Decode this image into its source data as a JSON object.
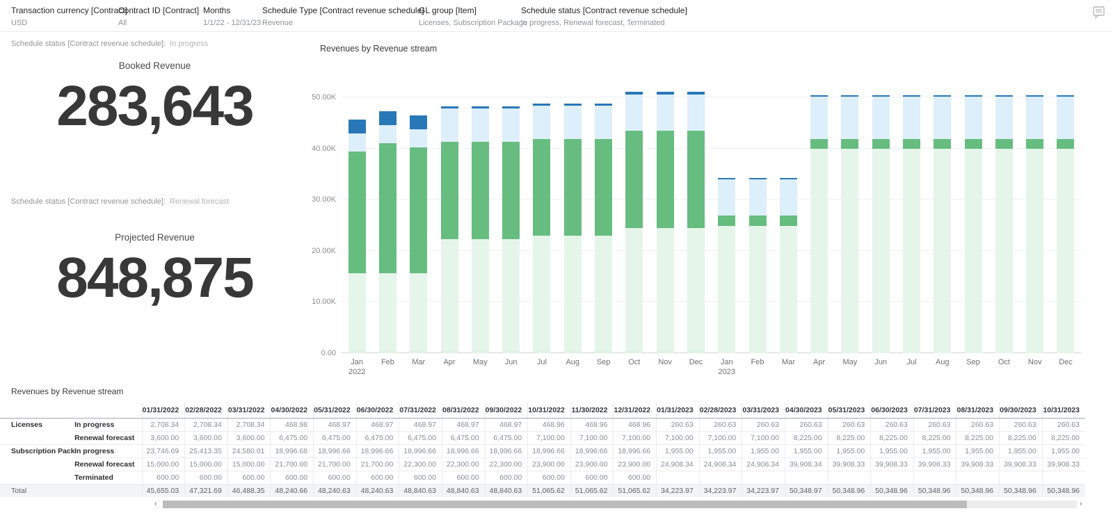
{
  "filters": [
    {
      "label": "Transaction currency [Contract]",
      "value": "USD"
    },
    {
      "label": "Contract ID [Contract]",
      "value": "All"
    },
    {
      "label": "Months",
      "value": "1/1/22 - 12/31/23"
    },
    {
      "label": "Schedule Type [Contract revenue schedule]",
      "value": "Revenue"
    },
    {
      "label": "GL group [Item]",
      "value": "Licenses, Subscription Package"
    },
    {
      "label": "Schedule status [Contract revenue schedule]",
      "value": "In progress, Renewal forecast, Terminated"
    }
  ],
  "kpis": [
    {
      "filter_label": "Schedule status [Contract revenue schedule]:",
      "filter_value": "In progress",
      "title": "Booked Revenue",
      "value": "283,643"
    },
    {
      "filter_label": "Schedule status [Contract revenue schedule]:",
      "filter_value": "Renewal forecast",
      "title": "Projected Revenue",
      "value": "848,875"
    }
  ],
  "chart_data": {
    "type": "bar",
    "stacked": true,
    "title": "Revenues by Revenue stream",
    "ylabel": "",
    "xlabel": "",
    "ylim": [
      0,
      50000
    ],
    "grid": true,
    "legend": "none",
    "y_ticks": [
      {
        "label": "0.00",
        "value": 0
      },
      {
        "label": "10.00K",
        "value": 10000
      },
      {
        "label": "20.00K",
        "value": 20000
      },
      {
        "label": "30.00K",
        "value": 30000
      },
      {
        "label": "40.00K",
        "value": 40000
      },
      {
        "label": "50.00K",
        "value": 50000
      }
    ],
    "categories": [
      {
        "month": "Jan",
        "year": "2022"
      },
      {
        "month": "Feb"
      },
      {
        "month": "Mar"
      },
      {
        "month": "Apr"
      },
      {
        "month": "May"
      },
      {
        "month": "Jun"
      },
      {
        "month": "Jul"
      },
      {
        "month": "Aug"
      },
      {
        "month": "Sep"
      },
      {
        "month": "Oct"
      },
      {
        "month": "Nov"
      },
      {
        "month": "Dec"
      },
      {
        "month": "Jan",
        "year": "2023"
      },
      {
        "month": "Feb"
      },
      {
        "month": "Mar"
      },
      {
        "month": "Apr"
      },
      {
        "month": "May"
      },
      {
        "month": "Jun"
      },
      {
        "month": "Jul"
      },
      {
        "month": "Aug"
      },
      {
        "month": "Sep"
      },
      {
        "month": "Oct"
      },
      {
        "month": "Nov"
      },
      {
        "month": "Dec"
      }
    ],
    "series": [
      {
        "name": "Subscription Package - Terminated",
        "color": "#e0f2e6",
        "values": [
          600,
          600,
          600,
          600,
          600,
          600,
          600,
          600,
          600,
          600,
          600,
          600,
          0,
          0,
          0,
          0,
          0,
          0,
          0,
          0,
          0,
          0,
          0,
          0
        ]
      },
      {
        "name": "Subscription Package - Renewal forecast",
        "color": "#e6f5ea",
        "values": [
          15000,
          15000,
          15000,
          21700,
          21700,
          21700,
          22300,
          22300,
          22300,
          23900,
          23900,
          23900,
          24908.34,
          24908.34,
          24908.34,
          39908.34,
          39908.33,
          39908.33,
          39908.33,
          39908.33,
          39908.33,
          39908.33,
          39908.33,
          39908.33
        ]
      },
      {
        "name": "Subscription Package - In progress",
        "color": "#66bd7f",
        "values": [
          23746.69,
          25413.35,
          24580.01,
          18996.68,
          18996.66,
          18996.66,
          18996.66,
          18996.66,
          18996.66,
          18996.66,
          18996.66,
          18996.66,
          1955,
          1955,
          1955,
          1955,
          1955,
          1955,
          1955,
          1955,
          1955,
          1955,
          1955,
          1955
        ]
      },
      {
        "name": "Licenses - Renewal forecast",
        "color": "#ddeffa",
        "values": [
          3600,
          3600,
          3600,
          6475,
          6475,
          6475,
          6475,
          6475,
          6475,
          7100,
          7100,
          7100,
          7100,
          7100,
          7100,
          8225,
          8225,
          8225,
          8225,
          8225,
          8225,
          8225,
          8225,
          8225
        ]
      },
      {
        "name": "Licenses - In progress",
        "color": "#2878b8",
        "values": [
          2708.34,
          2708.34,
          2708.34,
          468.98,
          468.97,
          468.97,
          468.97,
          468.97,
          468.97,
          468.96,
          468.96,
          468.96,
          260.63,
          260.63,
          260.63,
          260.63,
          260.63,
          260.63,
          260.63,
          260.63,
          260.63,
          260.63,
          260.63,
          260.63
        ]
      }
    ]
  },
  "table": {
    "title": "Revenues by Revenue stream",
    "columns": [
      "01/31/2022",
      "02/28/2022",
      "03/31/2022",
      "04/30/2022",
      "05/31/2022",
      "06/30/2022",
      "07/31/2022",
      "08/31/2022",
      "09/30/2022",
      "10/31/2022",
      "11/30/2022",
      "12/31/2022",
      "01/31/2023",
      "02/28/2023",
      "03/31/2023",
      "04/30/2023",
      "05/31/2023",
      "06/30/2023",
      "07/31/2023",
      "08/31/2023",
      "09/30/2023",
      "10/31/2023"
    ],
    "groups": [
      {
        "name": "Licenses",
        "rows": [
          {
            "status": "In progress",
            "values": [
              "2,708.34",
              "2,708.34",
              "2,708.34",
              "468.98",
              "468.97",
              "468.97",
              "468.97",
              "468.97",
              "468.97",
              "468.96",
              "468.96",
              "468.96",
              "260.63",
              "260.63",
              "260.63",
              "260.63",
              "260.63",
              "260.63",
              "260.63",
              "260.63",
              "260.63",
              "260.63"
            ]
          },
          {
            "status": "Renewal forecast",
            "values": [
              "3,600.00",
              "3,600.00",
              "3,600.00",
              "6,475.00",
              "6,475.00",
              "6,475.00",
              "6,475.00",
              "6,475.00",
              "6,475.00",
              "7,100.00",
              "7,100.00",
              "7,100.00",
              "7,100.00",
              "7,100.00",
              "7,100.00",
              "8,225.00",
              "8,225.00",
              "8,225.00",
              "8,225.00",
              "8,225.00",
              "8,225.00",
              "8,225.00"
            ]
          }
        ]
      },
      {
        "name": "Subscription Package",
        "rows": [
          {
            "status": "In progress",
            "values": [
              "23,746.69",
              "25,413.35",
              "24,580.01",
              "18,996.68",
              "18,996.66",
              "18,996.66",
              "18,996.66",
              "18,996.66",
              "18,996.66",
              "18,996.66",
              "18,996.66",
              "18,996.66",
              "1,955.00",
              "1,955.00",
              "1,955.00",
              "1,955.00",
              "1,955.00",
              "1,955.00",
              "1,955.00",
              "1,955.00",
              "1,955.00",
              "1,955.00"
            ]
          },
          {
            "status": "Renewal forecast",
            "values": [
              "15,000.00",
              "15,000.00",
              "15,000.00",
              "21,700.00",
              "21,700.00",
              "21,700.00",
              "22,300.00",
              "22,300.00",
              "22,300.00",
              "23,900.00",
              "23,900.00",
              "23,900.00",
              "24,908.34",
              "24,908.34",
              "24,908.34",
              "39,908.34",
              "39,908.33",
              "39,908.33",
              "39,908.33",
              "39,908.33",
              "39,908.33",
              "39,908.33"
            ]
          },
          {
            "status": "Terminated",
            "values": [
              "600.00",
              "600.00",
              "600.00",
              "600.00",
              "600.00",
              "600.00",
              "600.00",
              "600.00",
              "600.00",
              "600.00",
              "600.00",
              "600.00",
              "",
              "",
              "",
              "",
              "",
              "",
              "",
              "",
              "",
              ""
            ]
          }
        ]
      }
    ],
    "total": {
      "label": "Total",
      "values": [
        "45,655.03",
        "47,321.69",
        "46,488.35",
        "48,240.66",
        "48,240.63",
        "48,240.63",
        "48,840.63",
        "48,840.63",
        "48,840.63",
        "51,065.62",
        "51,065.62",
        "51,065.62",
        "34,223.97",
        "34,223.97",
        "34,223.97",
        "50,348.97",
        "50,348.96",
        "50,348.96",
        "50,348.96",
        "50,348.96",
        "50,348.96",
        "50,348.96"
      ]
    }
  },
  "scrollbar": {
    "left_arrow": "‹",
    "right_arrow": "›"
  }
}
